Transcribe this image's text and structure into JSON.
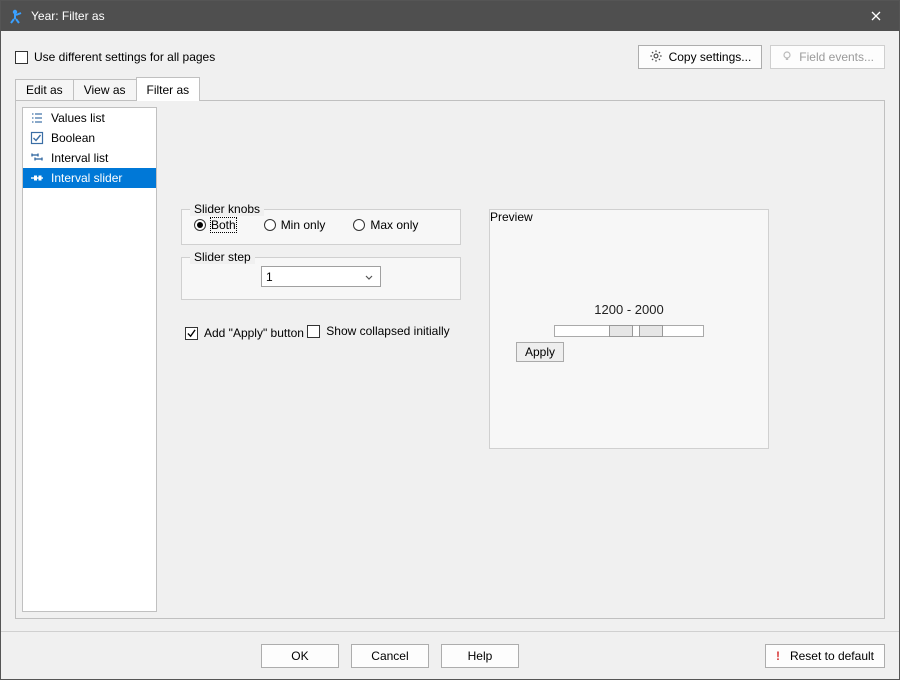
{
  "window": {
    "title": "Year: Filter as"
  },
  "toprow": {
    "diff_settings_label": "Use different settings for all pages",
    "copy_settings_label": "Copy settings...",
    "field_events_label": "Field events..."
  },
  "tabs": {
    "edit": "Edit as",
    "view": "View as",
    "filter": "Filter as"
  },
  "list": {
    "values": "Values list",
    "boolean": "Boolean",
    "interval_list": "Interval list",
    "interval_slider": "Interval slider"
  },
  "knobs": {
    "legend": "Slider knobs",
    "both": "Both",
    "min": "Min only",
    "max": "Max only"
  },
  "step": {
    "legend": "Slider step",
    "value": "1"
  },
  "options": {
    "add_apply": "Add \"Apply\" button",
    "collapsed": "Show collapsed initially"
  },
  "preview": {
    "legend": "Preview",
    "range": "1200 - 2000",
    "apply": "Apply"
  },
  "footer": {
    "ok": "OK",
    "cancel": "Cancel",
    "help": "Help",
    "reset": "Reset to default"
  }
}
